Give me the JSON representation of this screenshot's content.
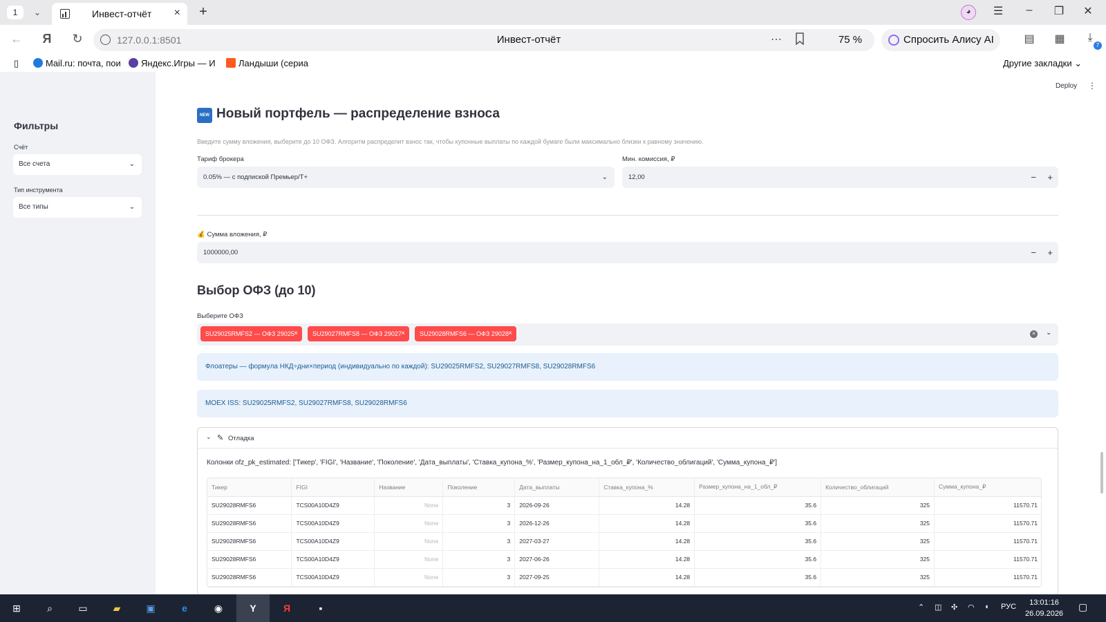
{
  "browser": {
    "tab_count": "1",
    "tab_title": "Инвест-отчёт",
    "url": "127.0.0.1:8501",
    "page_title": "Инвест-отчёт",
    "zoom": "75 %",
    "alice_label": "Спросить Алису AI",
    "downloads_badge": "7",
    "bookmarks": [
      {
        "label": "Mail.ru: почта, пои"
      },
      {
        "label": "Яндекс.Игры — И"
      },
      {
        "label": "Ландыши (сериа"
      }
    ],
    "other_bookmarks": "Другие закладки"
  },
  "sidebar": {
    "title": "Фильтры",
    "account_label": "Счёт",
    "account_value": "Все счета",
    "type_label": "Тип инструмента",
    "type_value": "Все типы"
  },
  "header": {
    "deploy": "Deploy"
  },
  "main": {
    "title": "Новый портфель — распределение взноса",
    "new_icon_text": "NEW",
    "caption": "Введите сумму вложения, выберите до 10 ОФЗ. Алгоритм распределит взнос так, чтобы купонные выплаты по каждой бумаге были максимально близки к равному значению.",
    "tariff_label": "Тариф брокера",
    "tariff_value": "0.05% — с подпиской Премьер/Т+",
    "min_fee_label": "Мин. комиссия, ₽",
    "min_fee_value": "12,00",
    "amount_label": "Сумма вложения, ₽",
    "amount_value": "1000000,00",
    "ofz_title": "Выбор ОФЗ (до 10)",
    "ofz_select_label": "Выберите ОФЗ",
    "selected_tags": [
      "SU29025RMFS2 — ОФЗ 29025",
      "SU29027RMFS8 — ОФЗ 29027",
      "SU29028RMFS6 — ОФЗ 29028"
    ],
    "info_floaters": "Флоатеры — формула НКД÷дни×период (индивидуально по каждой): SU29025RMFS2, SU29027RMFS8, SU29028RMFS6",
    "info_moex": "MOEX ISS: SU29025RMFS2, SU29027RMFS8, SU29028RMFS6",
    "debug_title": "Отладка",
    "columns_text": "Колонки ofz_pk_estimated: ['Тикер', 'FIGI', 'Название', 'Поколение', 'Дата_выплаты', 'Ставка_купона_%', 'Размер_купона_на_1_обл_₽', 'Количество_облигаций', 'Сумма_купона_₽']"
  },
  "table": {
    "headers": [
      "Тикер",
      "FIGI",
      "Название",
      "Поколение",
      "Дата_выплаты",
      "Ставка_купона_%",
      "Размер_купона_на_1_обл_₽",
      "Количество_облигаций",
      "Сумма_купона_₽"
    ],
    "rows": [
      [
        "SU29028RMFS6",
        "TCS00A10D4Z9",
        "None",
        "3",
        "2026-09-26",
        "14.28",
        "35.6",
        "325",
        "11570.71"
      ],
      [
        "SU29028RMFS6",
        "TCS00A10D4Z9",
        "None",
        "3",
        "2026-12-26",
        "14.28",
        "35.6",
        "325",
        "11570.71"
      ],
      [
        "SU29028RMFS6",
        "TCS00A10D4Z9",
        "None",
        "3",
        "2027-03-27",
        "14.28",
        "35.6",
        "325",
        "11570.71"
      ],
      [
        "SU29028RMFS6",
        "TCS00A10D4Z9",
        "None",
        "3",
        "2027-06-26",
        "14.28",
        "35.6",
        "325",
        "11570.71"
      ],
      [
        "SU29028RMFS6",
        "TCS00A10D4Z9",
        "None",
        "3",
        "2027-09-25",
        "14.28",
        "35.6",
        "325",
        "11570.71"
      ]
    ]
  },
  "taskbar": {
    "lang": "РУС",
    "time": "13:01:16",
    "date": "26.09.2026"
  },
  "colors": {
    "accent": "#ff4b4b",
    "info_bg": "#e8f1fc",
    "info_text": "#1c5e91",
    "sidebar_bg": "#f0f2f6"
  }
}
